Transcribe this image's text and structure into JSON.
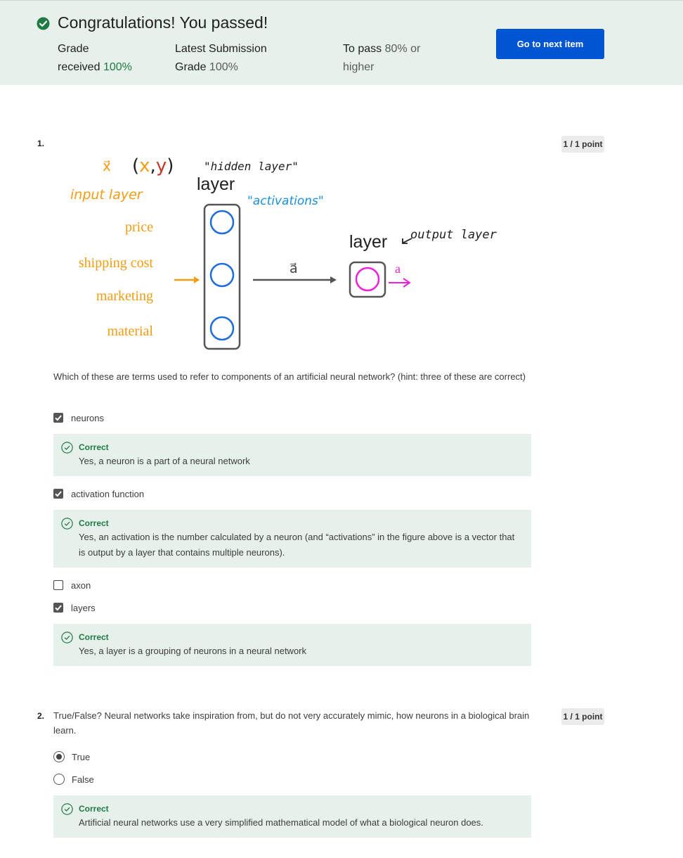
{
  "banner": {
    "title": "Congratulations! You passed!",
    "grade_received_label_1": "Grade",
    "grade_received_label_2": "received",
    "grade_received_value": "100%",
    "latest_label_1": "Latest Submission",
    "latest_label_2": "Grade",
    "latest_value": "100%",
    "to_pass_label": "To pass",
    "to_pass_value": "80% or",
    "to_pass_value_2": "higher",
    "next_button": "Go to next item"
  },
  "questions": [
    {
      "number": "1.",
      "points": "1 / 1 point",
      "figure": {
        "xy_label": "(x,y)",
        "x_vec": "x⃗",
        "hidden_layer": "\"hidden layer\"",
        "layer_top": "layer",
        "input_layer": "input layer",
        "activations": "\"activations\"",
        "features": [
          "price",
          "shipping cost",
          "marketing",
          "material"
        ],
        "vector_label": "a⃗",
        "layer_out": "layer",
        "output_layer": "output layer",
        "a_out": "a"
      },
      "text": "Which of these are terms used to refer to components of an artificial neural network? (hint: three of these are correct)",
      "options": [
        {
          "label": "neurons",
          "checked": true
        },
        {
          "label": "activation function",
          "checked": true
        },
        {
          "label": "axon",
          "checked": false
        },
        {
          "label": "layers",
          "checked": true
        }
      ],
      "feedback": [
        {
          "label": "Correct",
          "text": "Yes, a neuron is a part of a neural network"
        },
        {
          "label": "Correct",
          "text": "Yes, an activation is the number calculated by a neuron (and “activations” in the figure above is a vector that is output by a layer that contains multiple neurons)."
        },
        {
          "label": "Correct",
          "text": "Yes, a layer is a grouping of neurons in a neural network"
        }
      ]
    },
    {
      "number": "2.",
      "points": "1 / 1 point",
      "text": "True/False? Neural networks take inspiration from, but do not very accurately mimic, how neurons in a biological brain learn.",
      "options": [
        {
          "label": "True",
          "selected": true
        },
        {
          "label": "False",
          "selected": false
        }
      ],
      "feedback": [
        {
          "label": "Correct",
          "text": "Artificial neural networks use a very simplified mathematical model of what a biological neuron does."
        }
      ]
    }
  ],
  "colors": {
    "accent": "#0056d2",
    "success": "#1f7a43",
    "banner_bg": "#e7f1ec",
    "feature_orange": "#f39c12",
    "activation_blue": "#1a8fdc",
    "neuron_blue": "#1d6ed8",
    "output_pink": "#ee22d8",
    "y_red": "#c0392b"
  }
}
